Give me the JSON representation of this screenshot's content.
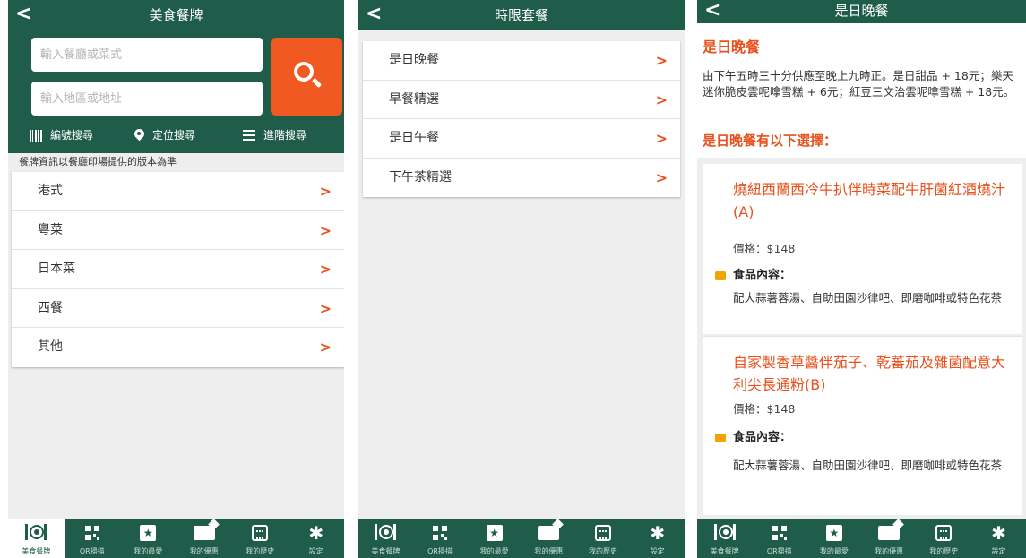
{
  "screens": [
    {
      "title": "美食餐牌",
      "back_icon": "chevron-left",
      "search": {
        "name_placeholder": "輸入餐廳或菜式",
        "area_placeholder": "輸入地區或地址",
        "button_icon": "search",
        "options": [
          {
            "icon": "barcode",
            "label": "編號搜尋"
          },
          {
            "icon": "map-pin",
            "label": "定位搜尋"
          },
          {
            "icon": "menu-lines",
            "label": "進階搜尋"
          }
        ]
      },
      "notice": "餐牌資訊以餐廳印場提供的版本為準",
      "categories": [
        "港式",
        "粵菜",
        "日本菜",
        "西餐",
        "其他"
      ]
    },
    {
      "title": "時限套餐",
      "back_icon": "chevron-left",
      "sets": [
        "是日晚餐",
        "早餐精選",
        "是日午餐",
        "下午茶精選"
      ]
    },
    {
      "title": "是日晚餐",
      "back_icon": "chevron-left",
      "heading": "是日晚餐",
      "description": "由下午五時三十分供應至晚上九時正。是日甜品 + 18元；樂天迷你脆皮雲呢嗱雪糕 + 6元；紅豆三文治雲呢嗱雪糕 + 18元。",
      "options_heading": "是日晚餐有以下選擇：",
      "options": [
        {
          "name": "燒紐西蘭西冷牛扒伴時菜配牛肝菌紅酒燒汁(A)",
          "price": "價格：$148",
          "contents_label": "食品內容：",
          "contents": "配大蒜薯蓉湯、自助田園沙律吧、即磨咖啡或特色花茶"
        },
        {
          "name": "自家製香草醬伴茄子、乾蕃茄及雜菌配意大利尖長通粉(B)",
          "price": "價格：$148",
          "contents_label": "食品內容：",
          "contents": "配大蒜薯蓉湯、自助田園沙律吧、即磨咖啡或特色花茶"
        }
      ]
    }
  ],
  "tabs": [
    {
      "icon": "dish-icon",
      "label": "美食餐牌"
    },
    {
      "icon": "qr-icon",
      "label": "QR掃描"
    },
    {
      "icon": "bookmark-star-icon",
      "label": "我的最愛"
    },
    {
      "icon": "ticket-icon",
      "label": "我的優惠"
    },
    {
      "icon": "calendar-icon",
      "label": "我的歷史"
    },
    {
      "icon": "gear-icon",
      "label": "設定"
    }
  ],
  "colors": {
    "primary": "#1f5c4a",
    "accent": "#f05a22",
    "link": "#e8511c",
    "bullet": "#f0a500"
  }
}
